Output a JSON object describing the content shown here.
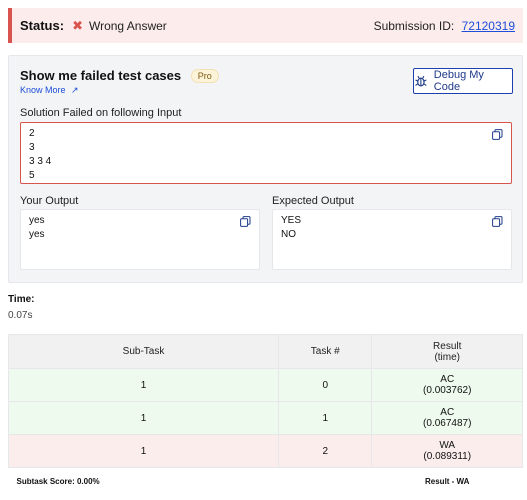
{
  "status": {
    "label": "Status:",
    "result": "Wrong Answer",
    "submission_label": "Submission ID:",
    "submission_id": "72120319"
  },
  "failed_cases": {
    "title": "Show me failed test cases",
    "badge": "Pro",
    "know_more": "Know More",
    "debug_button": "Debug My Code",
    "input_label": "Solution Failed on following Input",
    "input_lines": [
      "2",
      "3",
      "3 3 4",
      "5"
    ],
    "your_output_label": "Your Output",
    "your_output_lines": [
      "yes",
      "yes"
    ],
    "expected_output_label": "Expected Output",
    "expected_output_lines": [
      "YES",
      "NO"
    ]
  },
  "time": {
    "label": "Time:",
    "value": "0.07s"
  },
  "results_table": {
    "headers": {
      "subtask": "Sub-Task",
      "task": "Task #",
      "result_line1": "Result",
      "result_line2": "(time)"
    },
    "rows": [
      {
        "subtask": "1",
        "task": "0",
        "result": "AC",
        "time": "(0.003762)"
      },
      {
        "subtask": "1",
        "task": "1",
        "result": "AC",
        "time": "(0.067487)"
      },
      {
        "subtask": "1",
        "task": "2",
        "result": "WA",
        "time": "(0.089311)"
      }
    ],
    "subtask_score": "Subtask Score: 0.00%",
    "overall_result": "Result - WA"
  },
  "colors": {
    "error": "#d9534f",
    "accepted_bg": "#eefaee",
    "wrong_bg": "#fceded",
    "link": "#1d4ed8"
  }
}
